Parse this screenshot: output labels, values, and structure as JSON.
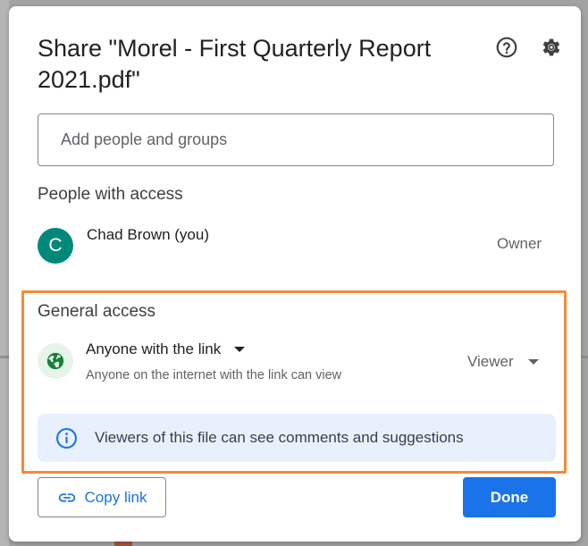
{
  "dialog": {
    "title": "Share \"Morel - First Quarterly Report 2021.pdf\"",
    "help_icon": "help-circle-icon",
    "settings_icon": "gear-icon"
  },
  "add_people": {
    "placeholder": "Add people and groups",
    "value": ""
  },
  "people_with_access": {
    "heading": "People with access",
    "people": [
      {
        "avatar_initial": "C",
        "avatar_color": "#00897b",
        "name": "Chad Brown (you)",
        "role": "Owner"
      }
    ]
  },
  "general_access": {
    "heading": "General access",
    "icon": "globe-icon",
    "access_level": "Anyone with the link",
    "description": "Anyone on the internet with the link can view",
    "role": "Viewer",
    "highlight_color": "#f7893a"
  },
  "info_banner": {
    "icon": "info-icon",
    "text": "Viewers of this file can see comments and suggestions"
  },
  "footer": {
    "copy_link_label": "Copy link",
    "copy_link_icon": "link-icon",
    "done_label": "Done"
  },
  "colors": {
    "accent": "#1a73e8",
    "globe_bg": "#e6f4ea",
    "globe_fg": "#188038",
    "banner_bg": "#e8f0fe"
  }
}
